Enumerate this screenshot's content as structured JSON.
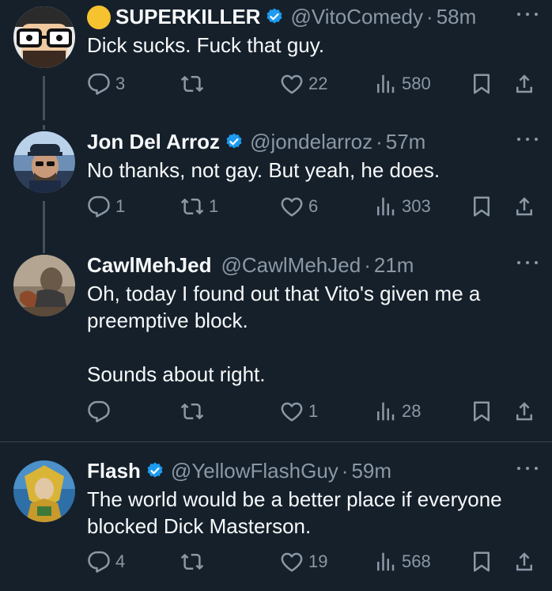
{
  "tweets": [
    {
      "emoji": "sun-emoji",
      "name": "SUPERKILLER",
      "verified": true,
      "handle": "@VitoComedy",
      "dot": "·",
      "time": "58m",
      "text": "Dick sucks. Fuck that guy.",
      "replies": "3",
      "retweets": "",
      "likes": "22",
      "views": "580"
    },
    {
      "name": "Jon Del Arroz",
      "verified": true,
      "handle": "@jondelarroz",
      "dot": "·",
      "time": "57m",
      "text": "No thanks, not gay. But yeah, he does.",
      "replies": "1",
      "retweets": "1",
      "likes": "6",
      "views": "303"
    },
    {
      "name": "CawlMehJed",
      "verified": false,
      "handle": "@CawlMehJed",
      "dot": "·",
      "time": "21m",
      "text": "Oh, today I found out that Vito's given me a\npreemptive block.\n\nSounds about right.",
      "replies": "",
      "retweets": "",
      "likes": "1",
      "views": "28"
    },
    {
      "name": "Flash",
      "verified": true,
      "handle": "@YellowFlashGuy",
      "dot": "·",
      "time": "59m",
      "text": "The world would be a better place if everyone\nblocked Dick Masterson.",
      "replies": "4",
      "retweets": "",
      "likes": "19",
      "views": "568"
    }
  ],
  "colors": {
    "background": "#15202b",
    "text": "#f7f9f9",
    "secondary": "#8b98a5",
    "verified": "#1d9bf0",
    "divider": "#38444d"
  }
}
